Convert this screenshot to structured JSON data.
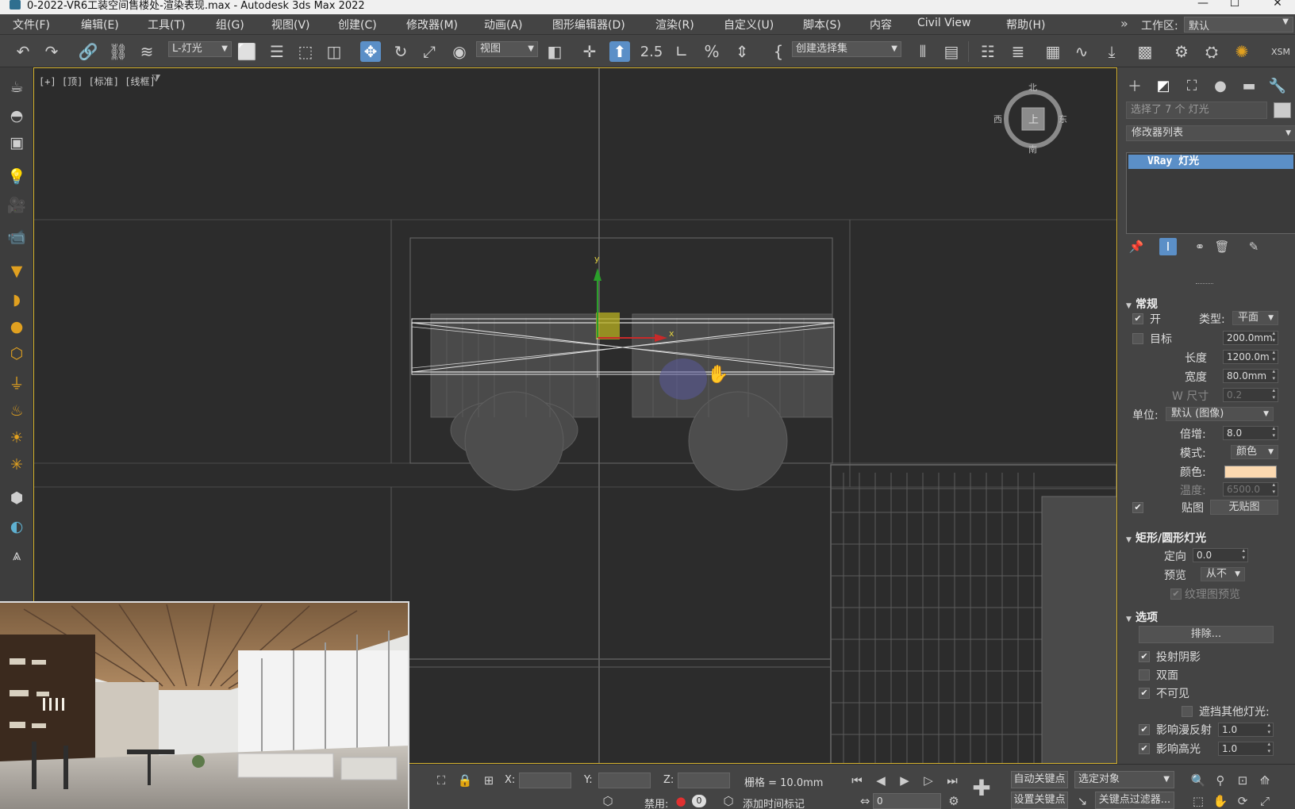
{
  "titlebar": {
    "title": "0-2022-VR6工装空间售楼处-渲染表现.max - Autodesk 3ds Max 2022",
    "minimize": "—",
    "maximize": "☐",
    "close": "✕"
  },
  "menu": {
    "items": [
      "文件(F)",
      "编辑(E)",
      "工具(T)",
      "组(G)",
      "视图(V)",
      "创建(C)",
      "修改器(M)",
      "动画(A)",
      "图形编辑器(D)",
      "渲染(R)",
      "自定义(U)",
      "脚本(S)",
      "内容",
      "Civil View",
      "帮助(H)"
    ],
    "overflow": "»",
    "workspace_label": "工作区:",
    "workspace_value": "默认"
  },
  "toolbar": {
    "selection_filter": "L-灯光",
    "ref_coord": "视图",
    "snap_value": "2.5",
    "named_selection": "创建选择集",
    "right_text": "XSM"
  },
  "viewport": {
    "label": "[+] [顶] [标准] [线框]",
    "gizmo_x": "x",
    "gizmo_y": "y",
    "viewcube": {
      "face": "上",
      "north": "北",
      "south": "南",
      "east": "东",
      "west": "西"
    }
  },
  "panel": {
    "selection_info": "选择了 7 个 灯光",
    "modifier_list": "修改器列表",
    "stack_item": "VRay 灯光",
    "sections": {
      "general": "常规",
      "rect_disc": "矩形/圆形灯光",
      "options": "选项"
    },
    "general": {
      "on_label": "开",
      "type_label": "类型:",
      "type_value": "平面",
      "target_label": "目标",
      "target_value": "200.0mm",
      "length_label": "长度",
      "length_value": "1200.0m",
      "width_label": "宽度",
      "width_value": "80.0mm",
      "wsize_label": "W 尺寸",
      "wsize_value": "0.2",
      "units_label": "单位:",
      "units_value": "默认 (图像)",
      "multiplier_label": "倍增:",
      "multiplier_value": "8.0",
      "mode_label": "模式:",
      "mode_value": "颜色",
      "color_label": "颜色:",
      "color_hex": "#fcd9b0",
      "temp_label": "温度:",
      "temp_value": "6500.0",
      "texture_label": "贴图",
      "texture_value": "无贴图"
    },
    "rect_disc": {
      "directional_label": "定向",
      "directional_value": "0.0",
      "preview_label": "预览",
      "preview_value": "从不",
      "texmap_preview_label": "纹理图预览"
    },
    "options": {
      "exclude_button": "排除...",
      "cast_shadows": "投射阴影",
      "double_sided": "双面",
      "invisible": "不可见",
      "occlude_other": "遮挡其他灯光:",
      "affect_diffuse": "影响漫反射",
      "affect_diffuse_value": "1.0",
      "affect_specular": "影响高光",
      "affect_specular_value": "1.0"
    }
  },
  "statusbar": {
    "x_label": "X:",
    "y_label": "Y:",
    "z_label": "Z:",
    "grid_text": "栅格 = 10.0mm",
    "disabled_label": "禁用:",
    "disabled_count": "0",
    "add_time_tag": "添加时间标记",
    "auto_key": "自动关键点",
    "set_key": "设置关键点",
    "selected_object": "选定对象",
    "key_filters": "关键点过滤器...",
    "frame_value": "0"
  },
  "colors": {
    "accent": "#5b8fc7",
    "viewport_border": "#d7b42f",
    "light_color": "#fcd9b0"
  }
}
